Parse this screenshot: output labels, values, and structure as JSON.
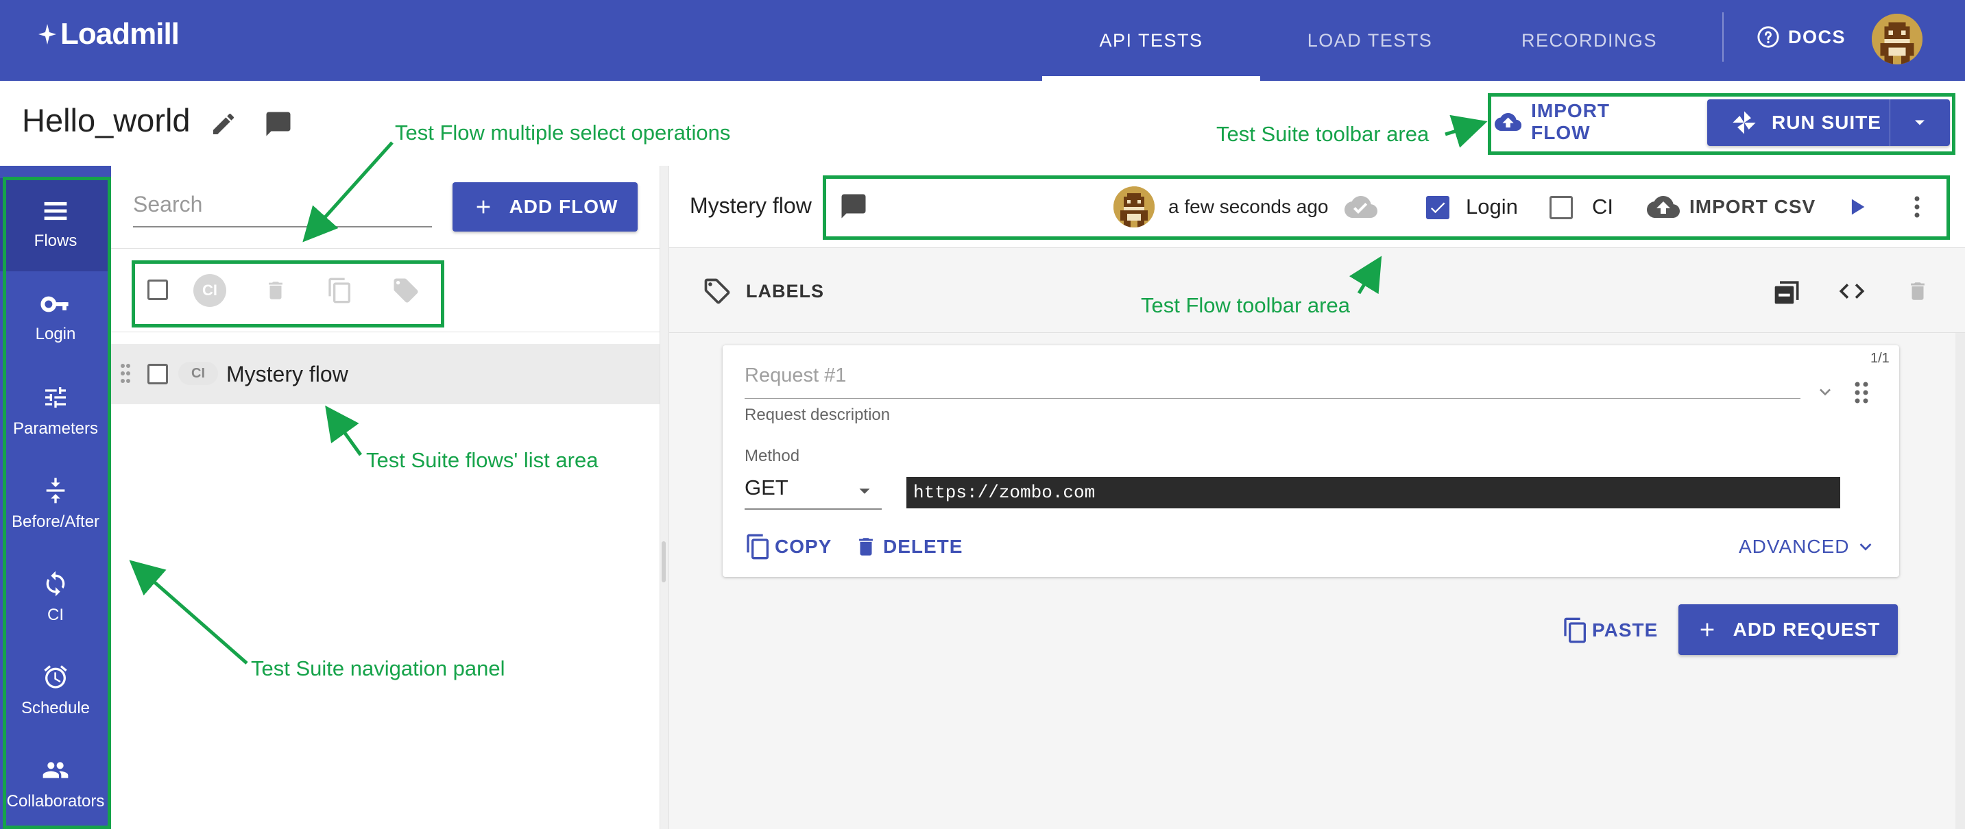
{
  "app": {
    "logo_text": "Loadmill",
    "nav_tabs": [
      {
        "label": "API TESTS",
        "active": true
      },
      {
        "label": "LOAD TESTS",
        "active": false
      },
      {
        "label": "RECORDINGS",
        "active": false
      }
    ],
    "docs_label": "DOCS"
  },
  "suite": {
    "title": "Hello_world",
    "import_flow_label": "IMPORT FLOW",
    "run_suite_label": "RUN SUITE"
  },
  "sidebar": {
    "items": [
      {
        "label": "Flows",
        "icon": "list-icon",
        "active": true
      },
      {
        "label": "Login",
        "icon": "key-icon",
        "active": false
      },
      {
        "label": "Parameters",
        "icon": "tune-icon",
        "active": false
      },
      {
        "label": "Before/After",
        "icon": "vertical-split-icon",
        "active": false
      },
      {
        "label": "CI",
        "icon": "sync-icon",
        "active": false
      },
      {
        "label": "Schedule",
        "icon": "alarm-icon",
        "active": false
      },
      {
        "label": "Collaborators",
        "icon": "people-icon",
        "active": false
      }
    ]
  },
  "flows_panel": {
    "search_placeholder": "Search",
    "add_flow_label": "ADD FLOW",
    "ci_badge": "CI",
    "flows": [
      {
        "name": "Mystery flow",
        "ci": "CI",
        "checked": false
      }
    ]
  },
  "flow": {
    "name": "Mystery flow",
    "last_saved": "a few seconds ago",
    "login_label": "Login",
    "login_checked": true,
    "ci_label": "CI",
    "ci_checked": false,
    "import_csv_label": "IMPORT CSV",
    "labels_label": "LABELS"
  },
  "request": {
    "counter": "1/1",
    "name_placeholder": "Request #1",
    "description_placeholder": "Request description",
    "method_label": "Method",
    "method": "GET",
    "url": "https://zombo.com",
    "copy_label": "COPY",
    "delete_label": "DELETE",
    "advanced_label": "ADVANCED",
    "paste_label": "PASTE",
    "add_request_label": "ADD REQUEST"
  },
  "annotations": {
    "multi_select": "Test Flow multiple select operations",
    "suite_toolbar": "Test Suite toolbar area",
    "flow_toolbar": "Test Flow toolbar area",
    "flows_list": "Test Suite flows' list area",
    "nav_panel": "Test Suite navigation panel"
  },
  "colors": {
    "primary": "#3f51b5",
    "annotation": "#16a34a",
    "background": "#f5f5f5"
  }
}
